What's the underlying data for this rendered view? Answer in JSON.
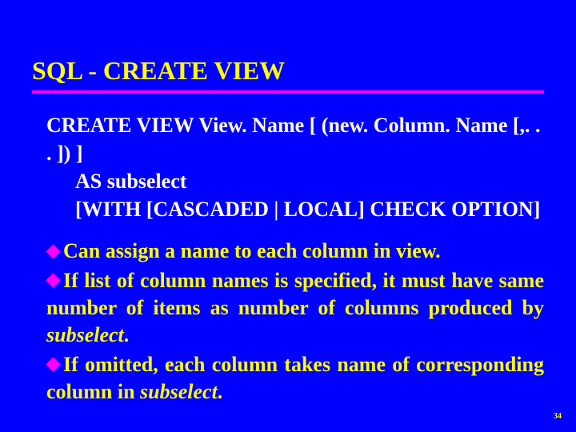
{
  "title": "SQL - CREATE VIEW",
  "syntax": {
    "line1": "CREATE VIEW View. Name [ (new. Column. Name [,. . . ]) ]",
    "line2": "AS subselect",
    "line3": "[WITH [CASCADED | LOCAL] CHECK OPTION]"
  },
  "bullets": {
    "b1": "Can assign a name to each column in view.",
    "b2_pre": "If list of column names is specified, it must have same number of items as number of columns produced by ",
    "b2_ital": "subselect",
    "b2_post": ".",
    "b3_pre": "If omitted, each column takes name of corresponding column in ",
    "b3_ital": "subselect",
    "b3_post": "."
  },
  "page": "34"
}
